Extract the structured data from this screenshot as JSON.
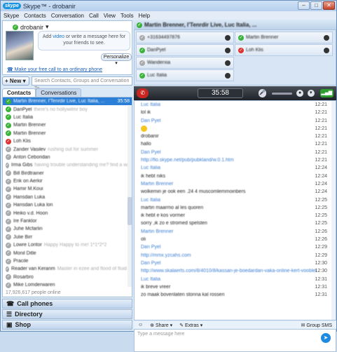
{
  "window": {
    "title": "Skype™ - drobanir",
    "logo": "skype"
  },
  "menu": [
    "Skype",
    "Contacts",
    "Conversation",
    "Call",
    "View",
    "Tools",
    "Help"
  ],
  "profile": {
    "name": "drobanir",
    "bubble_pre": "Add ",
    "bubble_link": "video",
    "bubble_post": " or write a message here for your friends to see.",
    "personalize": "Personalize",
    "free_call": "Make your free call to an ordinary phone"
  },
  "new_button": "New",
  "search_placeholder": "Search Contacts, Groups and Conversation To...",
  "tabs": [
    "Contacts",
    "Conversations"
  ],
  "contacts": [
    {
      "name": "Martin Brenner, l'Tenrdir Live, Luc Italia, ...",
      "time": "35:58",
      "status": "green",
      "selected": true
    },
    {
      "name": "DanPyel",
      "mood": "there's no hollywilmr boy",
      "status": "green"
    },
    {
      "name": "Luc Italia",
      "mood": "",
      "status": "green"
    },
    {
      "name": "Martin Brenner",
      "mood": "",
      "status": "green"
    },
    {
      "name": "Martin Brenner",
      "mood": "",
      "status": "green"
    },
    {
      "name": "Loh Klis",
      "mood": "",
      "status": "red"
    },
    {
      "name": "Zander Vasilev",
      "mood": "rushing out for summer",
      "status": "gray"
    },
    {
      "name": "Anton Ceboridan",
      "mood": "",
      "status": "gray"
    },
    {
      "name": "Irma Gibs",
      "mood": "having trouble understanding me? find a way",
      "status": "gray"
    },
    {
      "name": "Bill Birdtrainer",
      "mood": "",
      "status": "gray"
    },
    {
      "name": "Erik on Aerkir",
      "mood": "",
      "status": "gray"
    },
    {
      "name": "Hamir M.Koui",
      "mood": "",
      "status": "gray"
    },
    {
      "name": "Hansdan Luka",
      "mood": "",
      "status": "gray"
    },
    {
      "name": "Hansdan Luka lon",
      "mood": "",
      "status": "gray"
    },
    {
      "name": "Heiko v.d. Hoon",
      "mood": "",
      "status": "gray"
    },
    {
      "name": "Ire Fanklor",
      "mood": "",
      "status": "gray"
    },
    {
      "name": "Juhe Mcfarlin",
      "mood": "",
      "status": "gray"
    },
    {
      "name": "Julie Birr",
      "mood": "",
      "status": "gray"
    },
    {
      "name": "Lowre Loritor",
      "mood": "Happy Happy to me! 1*1*2*2",
      "status": "gray"
    },
    {
      "name": "Monil Ditle",
      "mood": "",
      "status": "gray"
    },
    {
      "name": "Pracile",
      "mood": "",
      "status": "gray"
    },
    {
      "name": "Reader van Keranm",
      "mood": "Master in ezee and flood of fluid dbl",
      "status": "gray"
    },
    {
      "name": "Rosarbro",
      "mood": "",
      "status": "gray"
    },
    {
      "name": "Mike Lomderwaren",
      "mood": "",
      "status": "gray"
    }
  ],
  "online_count": "17,926,617 people online",
  "nav_buttons": [
    "Call phones",
    "Directory",
    "Shop"
  ],
  "conversation": {
    "title": "Martin Brenner, l'Tenrdir Live, Luc Italia, ...",
    "participants": [
      {
        "name": "+31634497876",
        "status": "gray"
      },
      {
        "name": "DanPyel",
        "status": "green"
      },
      {
        "name": "Wanderxia",
        "status": "gray"
      },
      {
        "name": "Luc Italia",
        "status": "green"
      },
      {
        "name": "Martin Brenner",
        "status": "green"
      },
      {
        "name": "Loh Klis",
        "status": "red"
      }
    ],
    "call_timer": "35:58",
    "messages": [
      {
        "type": "sender",
        "text": "Luc Italia",
        "time": "12:21"
      },
      {
        "type": "text",
        "text": "lol ik",
        "time": "12:21"
      },
      {
        "type": "sender",
        "text": "Dan Pyel",
        "time": "12:21"
      },
      {
        "type": "emoticon",
        "text": "",
        "time": "12:21"
      },
      {
        "type": "text",
        "text": "drobanir",
        "time": "12:21"
      },
      {
        "type": "text",
        "text": "hallo",
        "time": "12:21"
      },
      {
        "type": "sender",
        "text": "Dan Pyel",
        "time": "12:21"
      },
      {
        "type": "link",
        "text": "http://flo.skype.net/pub/pubkland/w.0.1.htm",
        "time": "12:21"
      },
      {
        "type": "sender",
        "text": "Luc Italia",
        "time": "12:24"
      },
      {
        "type": "text",
        "text": "ik hebt niks",
        "time": "12:24"
      },
      {
        "type": "sender",
        "text": "Martin Brenner",
        "time": "12:24"
      },
      {
        "type": "text",
        "text": "wolkemin je ook een .24 4 muscomlemmoinbers",
        "time": "12:24"
      },
      {
        "type": "sender",
        "text": "Luc Italia",
        "time": "12:25"
      },
      {
        "type": "text",
        "text": "martin maarmo al les quoren",
        "time": "12:25"
      },
      {
        "type": "text",
        "text": "ik hebt e kos vormer",
        "time": "12:25"
      },
      {
        "type": "text",
        "text": "sorry ,ik zo e stromed spelsten",
        "time": "12:25"
      },
      {
        "type": "sender",
        "text": "Martin Brenner",
        "time": "12:26"
      },
      {
        "type": "text",
        "text": "oli",
        "time": "12:26"
      },
      {
        "type": "sender",
        "text": "Dan Pyel",
        "time": "12:29"
      },
      {
        "type": "link",
        "text": "http://mmx.yzcahs.com",
        "time": "12:29"
      },
      {
        "type": "sender",
        "text": "Dan Pyel",
        "time": "12:30"
      },
      {
        "type": "link",
        "text": "http://www.skalaerts.com/8/4010/8/kassan-je-boedardan-vaka-online-kert-vooblel",
        "time": "12:30"
      },
      {
        "type": "sender",
        "text": "Luc Italia",
        "time": "12:31"
      },
      {
        "type": "text",
        "text": "ik breve vreer",
        "time": "12:31"
      },
      {
        "type": "text",
        "text": "zo maak bovenlaten stonna kal rossen",
        "time": "12:31"
      }
    ],
    "toolbar": {
      "emoticon": "☺",
      "share": "Share",
      "extras": "Extras",
      "group_sms": "Group SMS"
    },
    "compose_placeholder": "Type a message here"
  }
}
